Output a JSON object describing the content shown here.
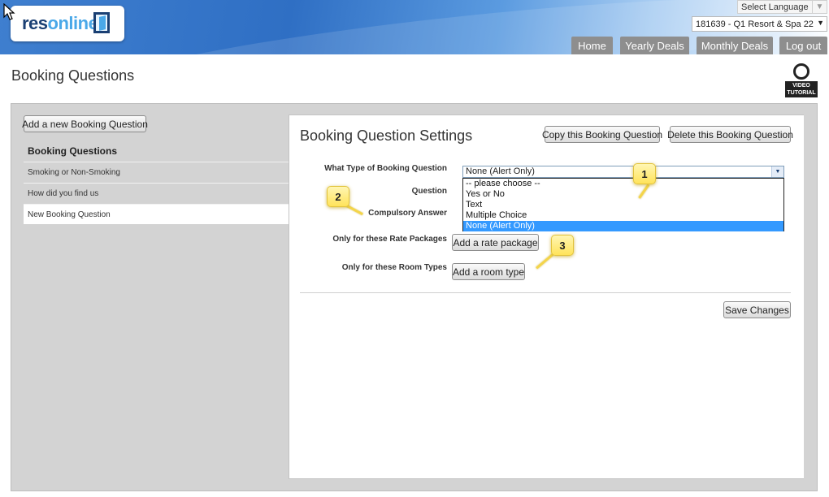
{
  "header": {
    "logo": {
      "part1": "res",
      "part2": "online"
    },
    "language_select": "Select Language",
    "property_select": "181639 - Q1 Resort & Spa 22",
    "nav": [
      "Home",
      "Yearly Deals",
      "Monthly Deals",
      "Log out"
    ]
  },
  "page_title": "Booking Questions",
  "video_tutorial": {
    "label_line1": "VIDEO",
    "label_line2": "TUTORIAL"
  },
  "sidebar": {
    "add_button": "Add a new Booking Question",
    "heading": "Booking Questions",
    "items": [
      "Smoking or Non-Smoking",
      "How did you find us",
      "New Booking Question"
    ]
  },
  "settings": {
    "title": "Booking Question Settings",
    "copy_button": "Copy this Booking Question",
    "delete_button": "Delete this Booking Question",
    "labels": {
      "type": "What Type of Booking Question",
      "question": "Question",
      "compulsory": "Compulsory Answer",
      "rate_packages": "Only for these Rate Packages",
      "room_types": "Only for these Room Types"
    },
    "type_select": {
      "value": "None (Alert Only)",
      "options": [
        "-- please choose --",
        "Yes or No",
        "Text",
        "Multiple Choice",
        "None (Alert Only)"
      ],
      "highlighted_index": 4
    },
    "add_rate_button": "Add a rate package",
    "add_room_button": "Add a room type",
    "save_button": "Save Changes"
  },
  "callouts": [
    "1",
    "2",
    "3"
  ],
  "colors": {
    "nav_bg": "#8e8e8e",
    "highlight": "#3399ff",
    "callout": "#ffe35a"
  }
}
